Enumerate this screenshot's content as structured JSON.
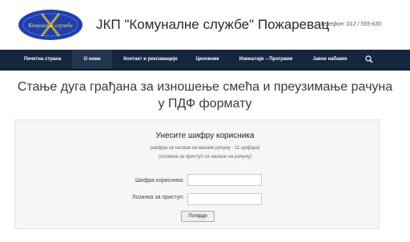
{
  "header": {
    "logo_text": "Комуналне службе",
    "title": "ЈКП \"Комуналне службе\" Пожаревац",
    "phone": "Телефон: 012 / 555-630"
  },
  "nav": {
    "items": [
      {
        "label": "Почетна страна",
        "active": false
      },
      {
        "label": "О нама",
        "active": true
      },
      {
        "label": "Контакт и рекламације",
        "active": false
      },
      {
        "label": "Ценовник",
        "active": false
      },
      {
        "label": "Извештаји – Програми",
        "active": false
      },
      {
        "label": "Јавне набавке",
        "active": false
      }
    ],
    "search_icon": "search-icon"
  },
  "main": {
    "title_line1": "Стање дуга грађана за изношење смећа и преузимање рачуна",
    "title_line2": "у ПДФ формату",
    "form": {
      "title": "Унесите шифру корисника",
      "note1": "(шифра се налази на вашем рачуну - 11 цифара)",
      "note2": "(лозинка за приступ се налази на рачуну)",
      "code_label": "Шифра корисника:",
      "code_value": "",
      "password_label": "Лозинка за приступ:",
      "password_value": "",
      "submit_label": "Потврди"
    }
  },
  "colors": {
    "nav_bg": "#15263f",
    "nav_active": "#23354f",
    "logo_blue": "#1f3fae",
    "logo_accent": "#e3c21a"
  }
}
